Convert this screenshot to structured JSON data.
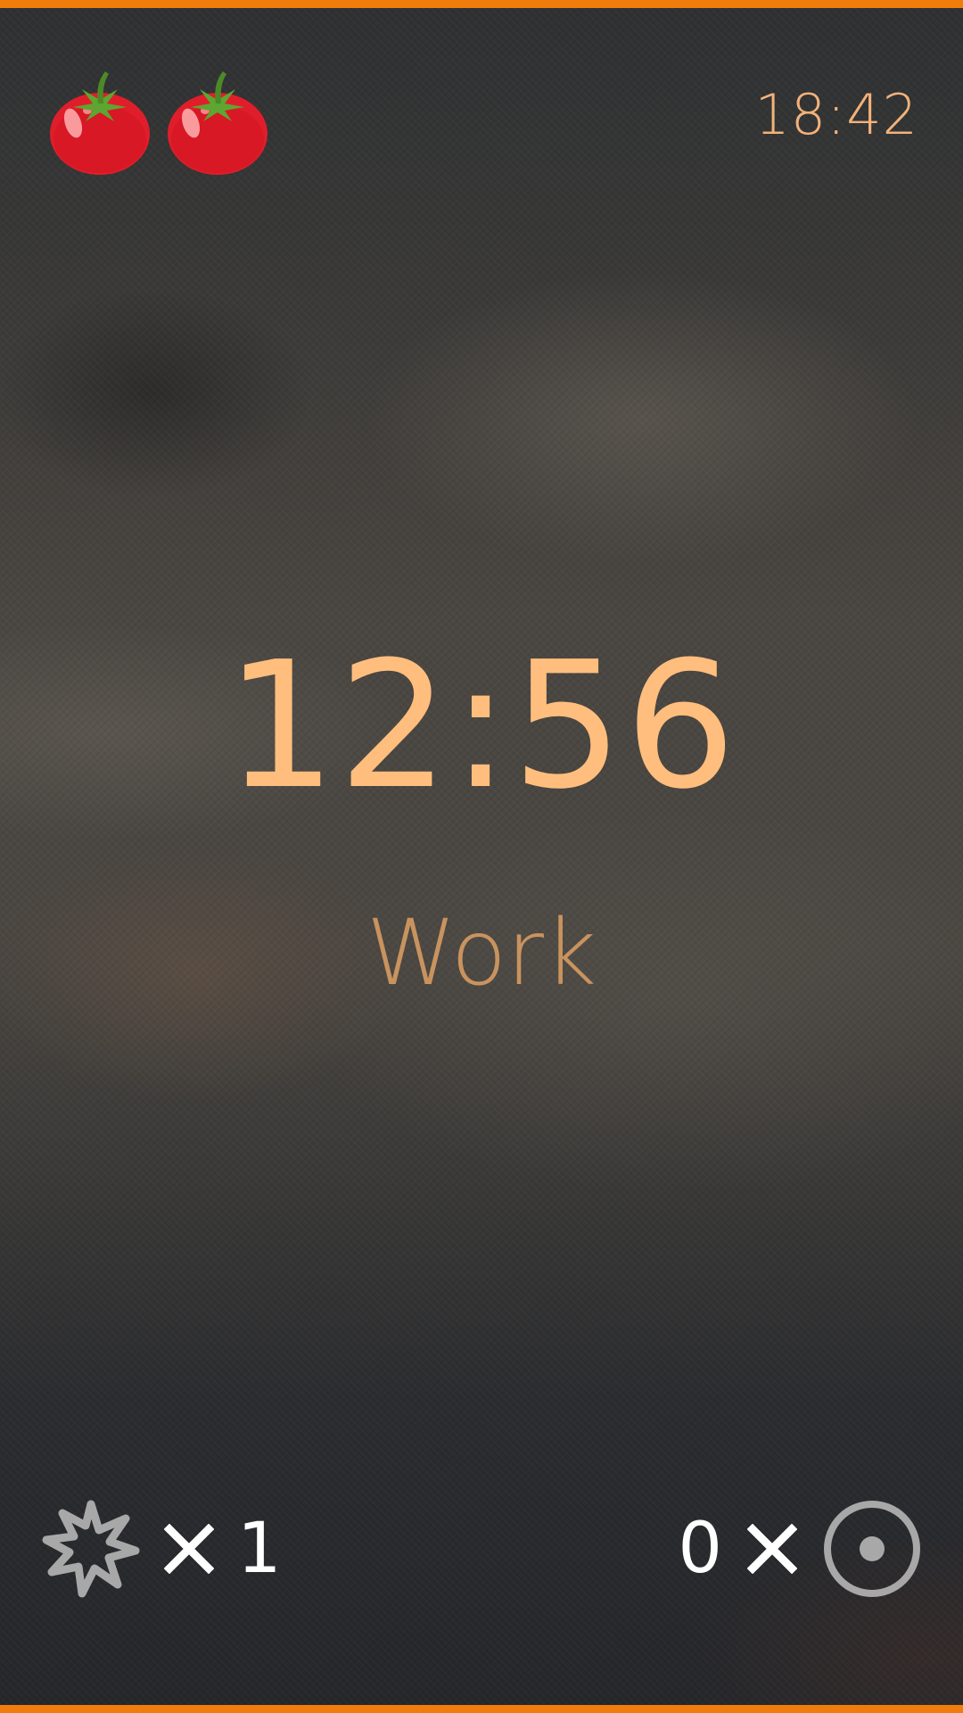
{
  "header": {
    "completed_icons": [
      "tomato-icon",
      "tomato-icon"
    ],
    "clock": "18:42"
  },
  "timer": {
    "remaining": "12:56",
    "phase": "Work"
  },
  "controls": {
    "left": {
      "icon": "burst-icon",
      "multiplier_symbol": "×",
      "count": "1"
    },
    "right": {
      "count": "0",
      "multiplier_symbol": "×",
      "icon": "target-icon"
    }
  },
  "colors": {
    "accent": "#f07c0b",
    "timer": "#ffbe7d",
    "phase_label": "#c9935f",
    "clock": "#f2b27a",
    "controls": "#ffffff",
    "icon_gray": "#a8a8a8"
  }
}
